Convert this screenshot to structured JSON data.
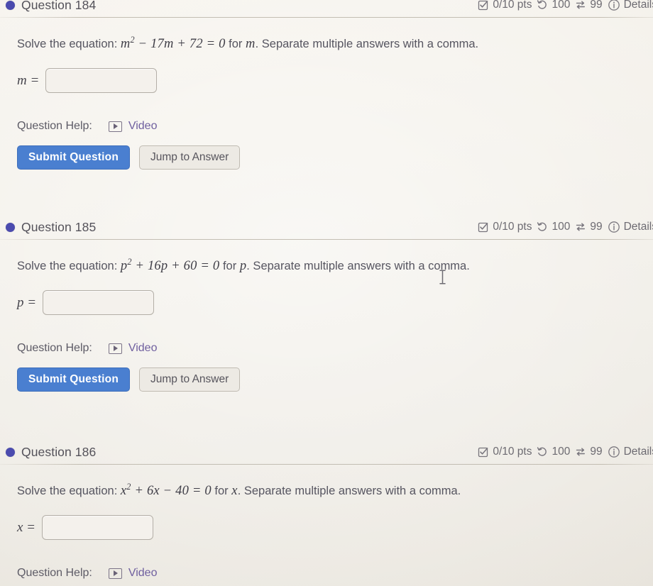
{
  "page": {
    "background_color": "#f1eee8",
    "accent_color": "#4a7fd0",
    "bullet_color": "#4b4bae",
    "link_color": "#6f5f9f"
  },
  "labels": {
    "question_help": "Question Help:",
    "video": "Video",
    "submit": "Submit Question",
    "jump": "Jump to Answer",
    "details": "Details",
    "points": "0/10 pts",
    "attempts": "100",
    "swaps": "99"
  },
  "questions": [
    {
      "title": "Question 184",
      "points": "0/10 pts",
      "attempts": "100",
      "swaps": "99",
      "details": "Details",
      "prompt_before": "Solve the equation:",
      "equation_var": "m",
      "equation_exp": "2",
      "equation_rest": "− 17m + 72 = 0",
      "prompt_after_var": "m",
      "prompt_after": ". Separate multiple answers with a comma.",
      "for_word": "for",
      "answer_var": "m =",
      "answer_value": "",
      "answer_placeholder": ""
    },
    {
      "title": "Question 185",
      "points": "0/10 pts",
      "attempts": "100",
      "swaps": "99",
      "details": "Details",
      "prompt_before": "Solve the equation:",
      "equation_var": "p",
      "equation_exp": "2",
      "equation_rest": "+ 16p + 60 = 0",
      "prompt_after_var": "p",
      "prompt_after": ". Separate multiple answers with a comma.",
      "for_word": "for",
      "answer_var": "p =",
      "answer_value": "",
      "answer_placeholder": ""
    },
    {
      "title": "Question 186",
      "points": "0/10 pts",
      "attempts": "100",
      "swaps": "99",
      "details": "Details",
      "prompt_before": "Solve the equation:",
      "equation_var": "x",
      "equation_exp": "2",
      "equation_rest": "+ 6x − 40 = 0",
      "prompt_after_var": "x",
      "prompt_after": ". Separate multiple answers with a comma.",
      "for_word": "for",
      "answer_var": "x =",
      "answer_value": "",
      "answer_placeholder": ""
    }
  ]
}
